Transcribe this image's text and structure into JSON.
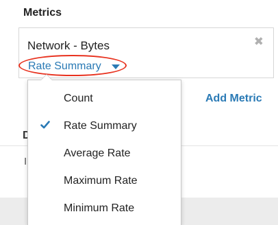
{
  "section": {
    "title": "Metrics"
  },
  "metric": {
    "name": "Network - Bytes",
    "remove_icon": "close-icon",
    "summary_selected": "Rate Summary"
  },
  "add_metric_label": "Add Metric",
  "behind": {
    "letter1": "D",
    "letter2": "I"
  },
  "dropdown": {
    "items": [
      {
        "label": "Count",
        "checked": false
      },
      {
        "label": "Rate Summary",
        "checked": true
      },
      {
        "label": "Average Rate",
        "checked": false
      },
      {
        "label": "Maximum Rate",
        "checked": false
      },
      {
        "label": "Minimum Rate",
        "checked": false
      }
    ]
  },
  "colors": {
    "link": "#2a7ab5",
    "highlight_ellipse": "#e8321f",
    "check": "#2a7ab5"
  }
}
